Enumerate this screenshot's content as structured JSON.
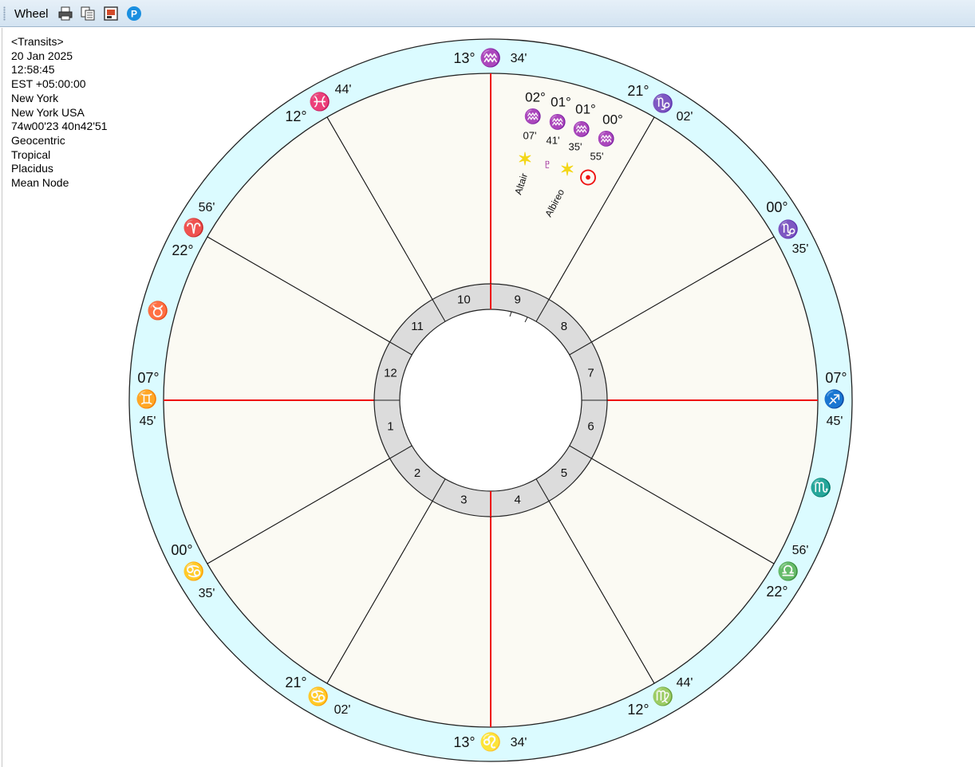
{
  "window": {
    "title": "Wheel",
    "tools": [
      {
        "icon": "printer-icon",
        "label": "Print"
      },
      {
        "icon": "copy-icon",
        "label": "Copy"
      },
      {
        "icon": "save-image-icon",
        "label": "Save image"
      },
      {
        "icon": "p-icon",
        "label": "P"
      }
    ]
  },
  "chart_info": [
    "<Transits>",
    "20 Jan 2025",
    "12:58:45",
    "EST +05:00:00",
    "New York",
    "New York USA",
    "74w00'23 40n42'51",
    "Geocentric",
    "Tropical",
    "Placidus",
    "Mean Node"
  ],
  "colors": {
    "zodiac_ring": "#dbfbff",
    "house_field": "#fbfaf3",
    "house_ring": "#dcdcdc",
    "axis_line": "#ee1111",
    "fire": "#ee1111",
    "earth": "#1d7a1d",
    "air": "#0a2fd6",
    "water": "#9a1f8a",
    "star": "#f3d617",
    "pluto": "#a02e9c",
    "sun": "#ee1111"
  },
  "house_numbers": [
    "1",
    "2",
    "3",
    "4",
    "5",
    "6",
    "7",
    "8",
    "9",
    "10",
    "11",
    "12"
  ],
  "cusps": [
    {
      "name": "mc",
      "deg": "13°",
      "sign": "♒",
      "min": "34'",
      "color": "#0a2fd6"
    },
    {
      "name": "cusp-11",
      "deg": "21°",
      "sign": "♑",
      "min": "02'",
      "color": "#1d7a1d"
    },
    {
      "name": "cusp-12",
      "deg": "00°",
      "sign": "♑",
      "min": "35'",
      "color": "#1d7a1d"
    },
    {
      "name": "asc",
      "deg": "07°",
      "sign": "♐",
      "min": "45'",
      "color": "#ee1111"
    },
    {
      "name": "cusp-2",
      "deg": "22°",
      "sign": "♎",
      "min": "56'",
      "color": "#0a2fd6"
    },
    {
      "name": "cusp-3",
      "deg": "12°",
      "sign": "♍",
      "min": "44'",
      "color": "#1d7a1d"
    },
    {
      "name": "ic",
      "deg": "13°",
      "sign": "♌",
      "min": "34'",
      "color": "#ee1111"
    },
    {
      "name": "cusp-5",
      "deg": "21°",
      "sign": "♋",
      "min": "02'",
      "color": "#9a1f8a"
    },
    {
      "name": "cusp-6",
      "deg": "00°",
      "sign": "♋",
      "min": "35'",
      "color": "#9a1f8a"
    },
    {
      "name": "dsc",
      "deg": "07°",
      "sign": "♊",
      "min": "45'",
      "color": "#0a2fd6"
    },
    {
      "name": "cusp-8",
      "deg": "22°",
      "sign": "♈",
      "min": "56'",
      "color": "#ee1111"
    },
    {
      "name": "cusp-9",
      "deg": "12°",
      "sign": "♓",
      "min": "44'",
      "color": "#9a1f8a"
    }
  ],
  "intercepted_signs": [
    {
      "name": "scorpio",
      "glyph": "♏",
      "color": "#9a1f8a"
    },
    {
      "name": "taurus",
      "glyph": "♉",
      "color": "#1d7a1d"
    }
  ],
  "planets": [
    {
      "name": "altair",
      "deg": "02°",
      "sign": "♒",
      "min": "07'",
      "glyph": "✶",
      "color": "#f3d617",
      "label": "Altair"
    },
    {
      "name": "pluto",
      "deg": "01°",
      "sign": "♒",
      "min": "41'",
      "glyph": "♇",
      "color": "#a02e9c",
      "label": ""
    },
    {
      "name": "albireo",
      "deg": "01°",
      "sign": "♒",
      "min": "35'",
      "glyph": "✶",
      "color": "#f3d617",
      "label": "Albireo"
    },
    {
      "name": "sun",
      "deg": "00°",
      "sign": "♒",
      "min": "55'",
      "glyph": "☉",
      "color": "#ee1111",
      "label": ""
    }
  ]
}
